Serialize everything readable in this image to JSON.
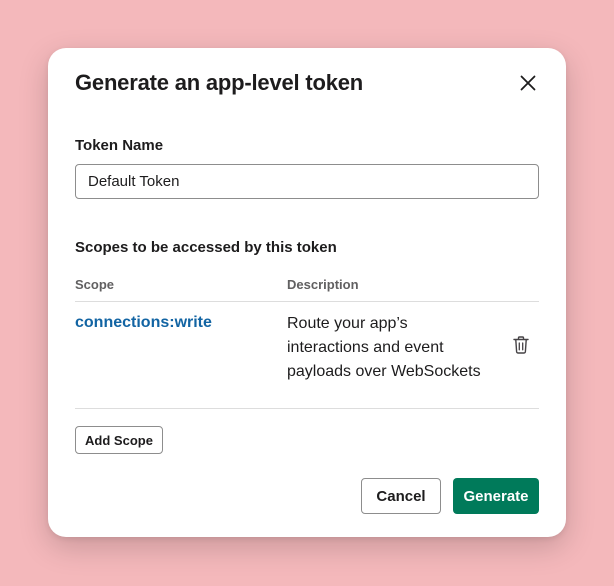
{
  "modal": {
    "title": "Generate an app-level token",
    "close_icon": "close-icon"
  },
  "token_name": {
    "label": "Token Name",
    "value": "Default Token"
  },
  "scopes": {
    "section_label": "Scopes to be accessed by this token",
    "columns": {
      "scope": "Scope",
      "description": "Description"
    },
    "rows": [
      {
        "scope": "connections:write",
        "description": "Route your app’s interactions and event payloads over WebSockets",
        "delete_icon": "trash-icon"
      }
    ],
    "add_label": "Add Scope"
  },
  "footer": {
    "cancel_label": "Cancel",
    "generate_label": "Generate"
  },
  "colors": {
    "background": "#f4b8bb",
    "link": "#1264a3",
    "primary": "#007a5a"
  }
}
